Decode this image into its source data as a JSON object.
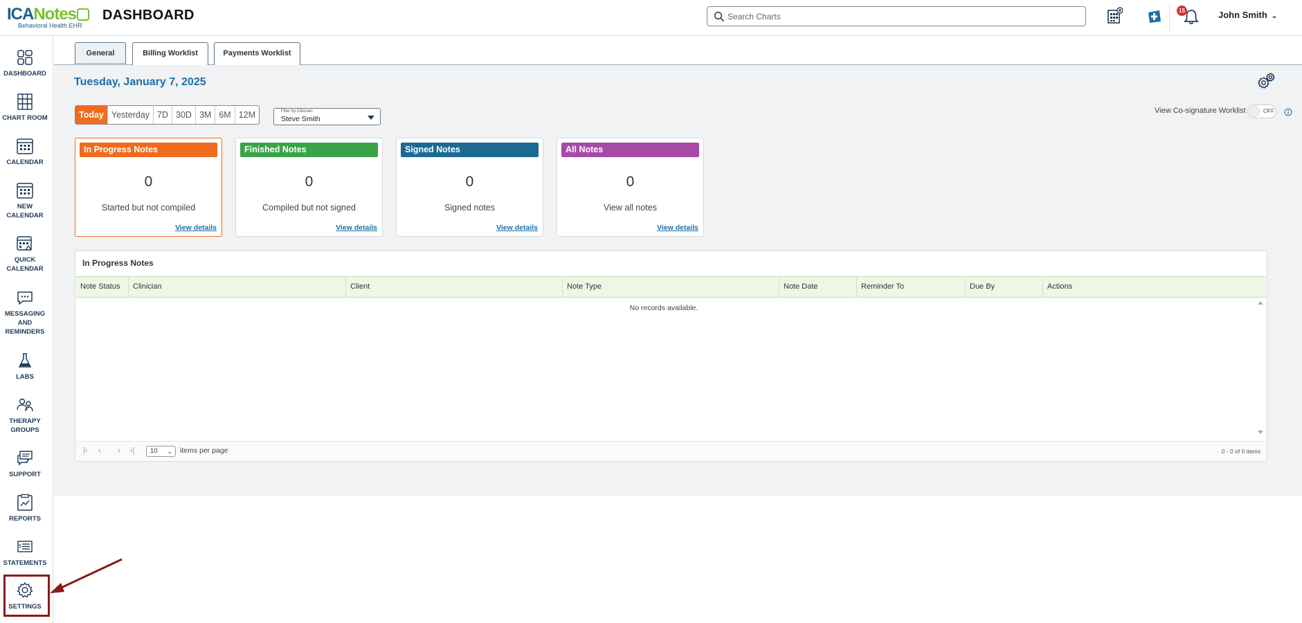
{
  "header": {
    "logo_ica": "ICA",
    "logo_notes": "Notes",
    "logo_sub": "Behavioral Health EHR",
    "title": "DASHBOARD",
    "search_placeholder": "Search Charts",
    "notification_count": "15",
    "user_name": "John Smith"
  },
  "sidebar": {
    "items": [
      {
        "label": "DASHBOARD",
        "icon": "dashboard-grid-icon"
      },
      {
        "label": "CHART ROOM",
        "icon": "chart-room-icon"
      },
      {
        "label": "CALENDAR",
        "icon": "calendar-icon"
      },
      {
        "label": "NEW CALENDAR",
        "icon": "new-calendar-icon"
      },
      {
        "label": "QUICK CALENDAR",
        "icon": "quick-calendar-icon"
      },
      {
        "label": "MESSAGING AND REMINDERS",
        "icon": "chat-bubble-icon"
      },
      {
        "label": "LABS",
        "icon": "flask-icon"
      },
      {
        "label": "THERAPY GROUPS",
        "icon": "people-icon"
      },
      {
        "label": "SUPPORT",
        "icon": "support-chat-icon"
      },
      {
        "label": "REPORTS",
        "icon": "report-icon"
      },
      {
        "label": "STATEMENTS",
        "icon": "statement-icon"
      },
      {
        "label": "SETTINGS",
        "icon": "gear-icon"
      }
    ]
  },
  "tabs": [
    {
      "label": "General",
      "active": true
    },
    {
      "label": "Billing Worklist",
      "active": false
    },
    {
      "label": "Payments Worklist",
      "active": false
    }
  ],
  "date_title": "Tuesday, January 7, 2025",
  "ranges": [
    "Today",
    "Yesterday",
    "7D",
    "30D",
    "3M",
    "6M",
    "12M"
  ],
  "active_range": "Today",
  "filter": {
    "label": "Filter by Clinician",
    "value": "Steve Smith"
  },
  "cosignature": {
    "label": "View Co-signature Worklist",
    "state": "OFF"
  },
  "cards": [
    {
      "title": "In Progress Notes",
      "count": "0",
      "desc": "Started but not compiled",
      "link": "View details",
      "color": "#f06b1e",
      "active": true
    },
    {
      "title": "Finished Notes",
      "count": "0",
      "desc": "Compiled but not signed",
      "link": "View details",
      "color": "#3aa34a",
      "active": false
    },
    {
      "title": "Signed Notes",
      "count": "0",
      "desc": "Signed notes",
      "link": "View details",
      "color": "#1c6a94",
      "active": false
    },
    {
      "title": "All Notes",
      "count": "0",
      "desc": "View all notes",
      "link": "View details",
      "color": "#a64aa8",
      "active": false
    }
  ],
  "grid": {
    "title": "In Progress Notes",
    "columns": [
      "Note Status",
      "Clinician",
      "Client",
      "Note Type",
      "Note Date",
      "Reminder To",
      "Due By",
      "Actions"
    ],
    "empty_text": "No records available.",
    "page_size": "10",
    "page_size_label": "items per page",
    "pager_info": "0 - 0 of 0 items"
  },
  "colors": {
    "accent_orange": "#f06b1e",
    "brand_blue": "#1b6ea8",
    "highlight": "#8b1a1a"
  }
}
